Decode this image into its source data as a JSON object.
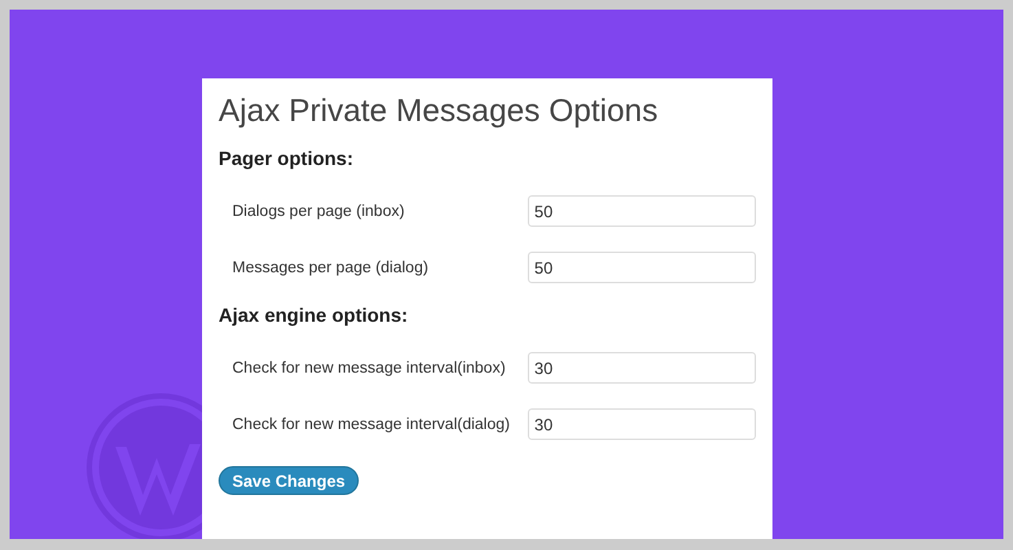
{
  "panel": {
    "title": "Ajax Private Messages Options",
    "sections": [
      {
        "heading": "Pager options:",
        "fields": [
          {
            "label": "Dialogs per page (inbox)",
            "value": "50"
          },
          {
            "label": "Messages per page (dialog)",
            "value": "50"
          }
        ]
      },
      {
        "heading": "Ajax engine options:",
        "fields": [
          {
            "label": "Check for new message interval(inbox)",
            "value": "30"
          },
          {
            "label": "Check for new message interval(dialog)",
            "value": "30"
          }
        ]
      }
    ],
    "button": "Save Changes"
  }
}
